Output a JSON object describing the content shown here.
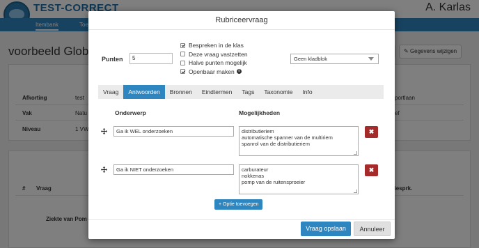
{
  "app": {
    "brand": "TEST-CORRECT",
    "user_name": "A. Karlas",
    "nav": [
      "Itembank",
      "Toe"
    ]
  },
  "background_page": {
    "title": "voorbeeld Glob",
    "buttons": [
      "",
      "Gegevens wijzigen"
    ],
    "fields": [
      {
        "label": "Afkorting",
        "value": "test",
        "right": "portlaan"
      },
      {
        "label": "Vak",
        "value": "Natu",
        "right": "ef"
      },
      {
        "label": "Niveau",
        "value": "1 VW",
        "right": ""
      }
    ],
    "table_headers": [
      "#",
      "Vraag",
      "Besprk."
    ],
    "row_text": "Ziekte van Pom"
  },
  "modal": {
    "title": "Rubriceervraag",
    "punten_label": "Punten",
    "punten_value": "5",
    "checkboxes": [
      {
        "label": "Bespreken in de klas",
        "checked": true
      },
      {
        "label": "Deze vraag vastzetten",
        "checked": false
      },
      {
        "label": "Halve punten mogelijk",
        "checked": false
      },
      {
        "label": "Openbaar maken",
        "checked": true
      }
    ],
    "info_glyph": "i",
    "kladblok_value": "Geen kladblok",
    "tabs": [
      {
        "label": "Vraag",
        "active": false
      },
      {
        "label": "Antwoorden",
        "active": true
      },
      {
        "label": "Bronnen",
        "active": false
      },
      {
        "label": "Eindtermen",
        "active": false
      },
      {
        "label": "Tags",
        "active": false
      },
      {
        "label": "Taxonomie",
        "active": false
      },
      {
        "label": "Info",
        "active": false
      }
    ],
    "columns": {
      "onderwerp": "Onderwerp",
      "mogelijkheden": "Mogelijkheden"
    },
    "rows": [
      {
        "onderwerp": "Ga ik WEL onderzoeken",
        "mogelijkheden": [
          "distributieriem",
          "automatische spanner van de multiriem",
          "spanrol van de distributieriem"
        ]
      },
      {
        "onderwerp": "Ga ik NIET onderzoeken",
        "mogelijkheden": [
          "carburateur",
          "nokkenas",
          "pomp van de ruitensproeier"
        ]
      }
    ],
    "delete_glyph": "✖",
    "add_option": "+ Optie toevoegen",
    "save": "Vraag opslaan",
    "cancel": "Annuleer"
  },
  "colors": {
    "accent": "#2e86c1",
    "danger": "#a52a2a",
    "brand": "#1b6ea8"
  }
}
